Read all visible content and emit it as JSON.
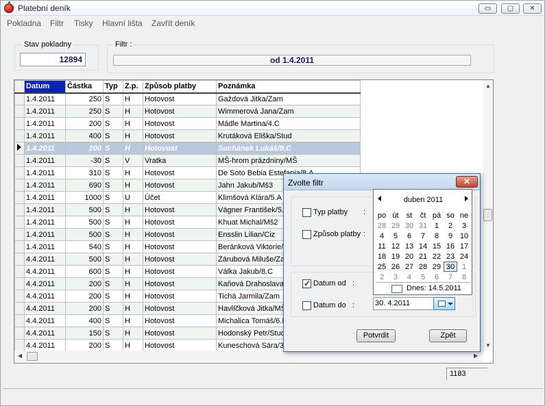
{
  "window": {
    "title": "Platební deník",
    "controls": {
      "minimize": "▭",
      "maximize": "▢",
      "close": "✕"
    }
  },
  "menu": [
    "Pokladna",
    "Filtr",
    "Tisky",
    "Hlavní lišta",
    "Zavřít deník"
  ],
  "stav": {
    "label": "Stav pokladny",
    "value": "12894"
  },
  "filtr": {
    "label": "Filtr :",
    "value": "od 1.4.2011"
  },
  "grid": {
    "columns": [
      "Datum",
      "Částka",
      "Typ",
      "Z.p.",
      "Způsob platby",
      "Poznámka"
    ],
    "rows": [
      [
        "1.4.2011",
        "250",
        "S",
        "H",
        "Hotovost",
        "Gaždová Jitka/Zam"
      ],
      [
        "1.4.2011",
        "250",
        "S",
        "H",
        "Hotovost",
        "Wimmerová Jana/Zam"
      ],
      [
        "1.4.2011",
        "200",
        "S",
        "H",
        "Hotovost",
        "Mádle Martina/4.C"
      ],
      [
        "1.4.2011",
        "400",
        "S",
        "H",
        "Hotovost",
        "Krutáková Eliška/Stud"
      ],
      [
        "1.4.2011",
        "200",
        "S",
        "H",
        "Hotovost",
        "Suchánek Lukáš/9.C"
      ],
      [
        "1.4.2011",
        "-30",
        "S",
        "V",
        "Vratka",
        "MŠ-hrom prázdniny/MŠ"
      ],
      [
        "1.4.2011",
        "310",
        "S",
        "H",
        "Hotovost",
        "De  Soto Bebia Estefania/8.A"
      ],
      [
        "1.4.2011",
        "690",
        "S",
        "H",
        "Hotovost",
        "Jahn Jakub/Mš3"
      ],
      [
        "1.4.2011",
        "1000",
        "S",
        "U",
        "Účet",
        "Klimšová Klára/5.A"
      ],
      [
        "1.4.2011",
        "500",
        "S",
        "H",
        "Hotovost",
        "Vágner František/5.A"
      ],
      [
        "1.4.2011",
        "500",
        "S",
        "H",
        "Hotovost",
        "Khuat Michal/Mš2"
      ],
      [
        "1.4.2011",
        "500",
        "S",
        "H",
        "Hotovost",
        "Ensslin Lilian/Ciz"
      ],
      [
        "1.4.2011",
        "540",
        "S",
        "H",
        "Hotovost",
        "Beránková Viktorie/M"
      ],
      [
        "4.4.2011",
        "500",
        "S",
        "H",
        "Hotovost",
        "Zárubová Miluše/Zam"
      ],
      [
        "4.4.2011",
        "600",
        "S",
        "H",
        "Hotovost",
        "Válka Jakub/8.C"
      ],
      [
        "4.4.2011",
        "200",
        "S",
        "H",
        "Hotovost",
        "Kaňová Drahoslava/Z"
      ],
      [
        "4.4.2011",
        "200",
        "S",
        "H",
        "Hotovost",
        "Tichá Jarmila/Zam"
      ],
      [
        "4.4.2011",
        "200",
        "S",
        "H",
        "Hotovost",
        "Havlíčková Jitka/MŠ"
      ],
      [
        "4.4.2011",
        "400",
        "S",
        "H",
        "Hotovost",
        "Michalica Tomáš/6.B"
      ],
      [
        "4.4.2011",
        "150",
        "S",
        "H",
        "Hotovost",
        "Hodonský Petr/Stud"
      ],
      [
        "4.4.2011",
        "200",
        "S",
        "H",
        "Hotovost",
        "Kuneschová Sára/3."
      ]
    ],
    "current_row": 4
  },
  "count": "1183",
  "dialog": {
    "title": "Zvolte filtr",
    "close": "✕",
    "typ_platby": {
      "label": "Typ platby",
      "colon": ":"
    },
    "zpusob_platby": {
      "label": "Způsob platby",
      "colon": ":"
    },
    "datum_od": {
      "label": "Datum    od",
      "colon": ":"
    },
    "datum_do": {
      "label": "Datum    do",
      "colon": ":",
      "value": "30.  4.2011"
    },
    "confirm": "Potvrdit",
    "back": "Zpět"
  },
  "calendar": {
    "month": "duben 2011",
    "weekdays": [
      "po",
      "út",
      "st",
      "čt",
      "pá",
      "so",
      "ne"
    ],
    "weeks": [
      [
        "28",
        "29",
        "30",
        "31",
        "1",
        "2",
        "3"
      ],
      [
        "4",
        "5",
        "6",
        "7",
        "8",
        "9",
        "10"
      ],
      [
        "11",
        "12",
        "13",
        "14",
        "15",
        "16",
        "17"
      ],
      [
        "18",
        "19",
        "20",
        "21",
        "22",
        "23",
        "24"
      ],
      [
        "25",
        "26",
        "27",
        "28",
        "29",
        "30",
        "1"
      ],
      [
        "2",
        "3",
        "4",
        "5",
        "6",
        "7",
        "8"
      ]
    ],
    "today": "Dnes: 14.5.2011"
  }
}
